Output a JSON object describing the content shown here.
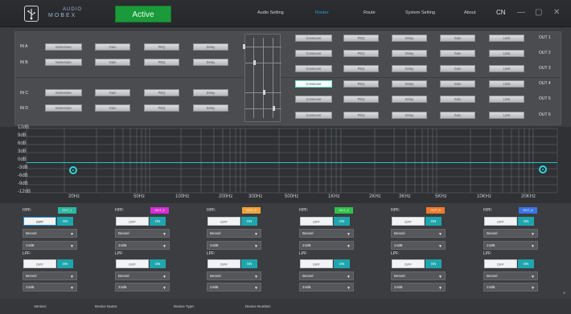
{
  "header": {
    "logo_line1": "AUDIO",
    "logo_line2": "MOBEX",
    "active_label": "Active",
    "nav": [
      "Audio Setting",
      "Router",
      "Route",
      "System Setting",
      "About"
    ],
    "nav_selected": 1,
    "language": "CN",
    "minimize": "—",
    "maximize": "▢",
    "close": "✕"
  },
  "routing": {
    "inputs": [
      {
        "label": "IN A",
        "modules": [
          "NoiseGate",
          "Gain",
          "PEQ",
          "Delay"
        ]
      },
      {
        "label": "IN B",
        "modules": [
          "NoiseGate",
          "Gain",
          "PEQ",
          "Delay"
        ]
      },
      {
        "label": "IN C",
        "modules": [
          "NoiseGate",
          "Gain",
          "PEQ",
          "Delay"
        ]
      },
      {
        "label": "IN D",
        "modules": [
          "NoiseGate",
          "Gain",
          "PEQ",
          "Delay"
        ]
      }
    ],
    "outputs": [
      {
        "label": "OUT 1",
        "modules": [
          "Crossover",
          "PEQ",
          "Delay",
          "Gain",
          "Limit"
        ]
      },
      {
        "label": "OUT 2",
        "modules": [
          "Crossover",
          "PEQ",
          "Delay",
          "Gain",
          "Limit"
        ]
      },
      {
        "label": "OUT 3",
        "modules": [
          "Crossover",
          "PEQ",
          "Delay",
          "Gain",
          "Limit"
        ]
      },
      {
        "label": "OUT 4",
        "modules": [
          "Crossover",
          "PEQ",
          "Delay",
          "Gain",
          "Limit"
        ]
      },
      {
        "label": "OUT 5",
        "modules": [
          "Crossover",
          "PEQ",
          "Delay",
          "Gain",
          "Limit"
        ]
      },
      {
        "label": "OUT 6",
        "modules": [
          "Crossover",
          "PEQ",
          "Delay",
          "Gain",
          "Limit"
        ]
      }
    ],
    "highlighted_output": 3
  },
  "graph": {
    "y_labels": [
      "12dB",
      "9dB",
      "6dB",
      "3dB",
      "0dB",
      "-3dB",
      "-6dB",
      "-9dB",
      "-12dB"
    ],
    "x_labels": [
      "20Hz",
      "50Hz",
      "100Hz",
      "200Hz",
      "300Hz",
      "500Hz",
      "1KHz",
      "2KHz",
      "3KHz",
      "5KHz",
      "10KHz",
      "20KHz"
    ],
    "curve_color": "#1fc4c8"
  },
  "channels": [
    {
      "hpf_label": "HPF:",
      "badge": "OUT_1",
      "badge_color": "#2ab7a0",
      "hpf_off": "OFF",
      "hpf_on": "ON",
      "hpf_type": "Bessel",
      "hpf_slope": "24dB",
      "lpf_label": "LPF:",
      "lpf_off": "OFF",
      "lpf_on": "ON",
      "lpf_type": "Bessel",
      "lpf_slope": "24dB"
    },
    {
      "hpf_label": "HPF:",
      "badge": "OUT_2",
      "badge_color": "#d42fd6",
      "hpf_off": "OFF",
      "hpf_on": "ON",
      "hpf_type": "Bessel",
      "hpf_slope": "24dB",
      "lpf_label": "LPF:",
      "lpf_off": "OFF",
      "lpf_on": "ON",
      "lpf_type": "Bessel",
      "lpf_slope": "24dB"
    },
    {
      "hpf_label": "HPF:",
      "badge": "OUT_3",
      "badge_color": "#f0a13a",
      "hpf_off": "OFF",
      "hpf_on": "ON",
      "hpf_type": "Bessel",
      "hpf_slope": "24dB",
      "lpf_label": "LPF:",
      "lpf_off": "OFF",
      "lpf_on": "ON",
      "lpf_type": "Bessel",
      "lpf_slope": "24dB"
    },
    {
      "hpf_label": "HPF:",
      "badge": "OUT_4",
      "badge_color": "#2fc24a",
      "hpf_off": "OFF",
      "hpf_on": "ON",
      "hpf_type": "Bessel",
      "hpf_slope": "24dB",
      "lpf_label": "LPF:",
      "lpf_off": "OFF",
      "lpf_on": "ON",
      "lpf_type": "Bessel",
      "lpf_slope": "24dB"
    },
    {
      "hpf_label": "HPF:",
      "badge": "OUT_5",
      "badge_color": "#f07a2a",
      "hpf_off": "OFF",
      "hpf_on": "ON",
      "hpf_type": "Bessel",
      "hpf_slope": "24dB",
      "lpf_label": "LPF:",
      "lpf_off": "OFF",
      "lpf_on": "ON",
      "lpf_type": "Bessel",
      "lpf_slope": "24dB"
    },
    {
      "hpf_label": "HPF:",
      "badge": "OUT_6",
      "badge_color": "#3a74e6",
      "hpf_off": "OFF",
      "hpf_on": "ON",
      "hpf_type": "Bessel",
      "hpf_slope": "24dB",
      "lpf_label": "LPF:",
      "lpf_off": "OFF",
      "lpf_on": "ON",
      "lpf_type": "Bessel",
      "lpf_slope": "24dB"
    }
  ],
  "status": {
    "version": "Version:",
    "device_name": "Device Name:",
    "device_type": "Device Type:",
    "device_number": "Device Number:"
  }
}
